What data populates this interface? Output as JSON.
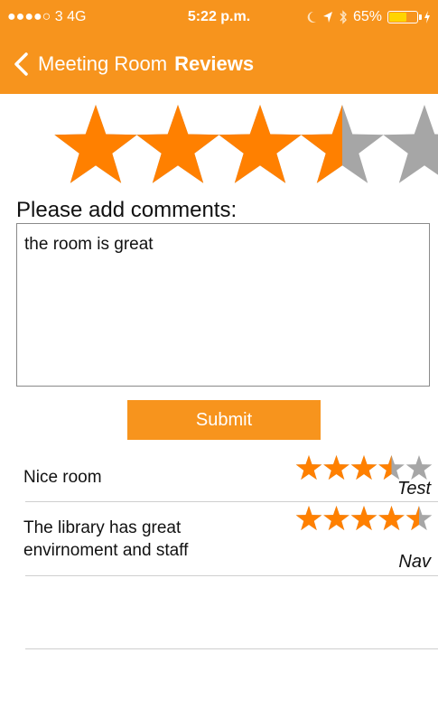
{
  "status_bar": {
    "carrier": "●●●●○ 3  4G",
    "time": "5:22 p.m.",
    "battery": "65%",
    "battery_level": 0.65,
    "icons": [
      "moon-icon",
      "location-arrow-icon",
      "bluetooth-icon",
      "battery-icon",
      "charging-icon"
    ]
  },
  "nav": {
    "back_label": "Meeting Room",
    "title": "Reviews"
  },
  "rating": {
    "value": 3.5,
    "max": 5
  },
  "comments": {
    "prompt": "Please add comments:",
    "value": "the room is great"
  },
  "submit_label": "Submit",
  "reviews": [
    {
      "text": "Nice room",
      "rating": 3.5,
      "max": 5,
      "user": "Test"
    },
    {
      "text": "The library has great envirnoment and staff",
      "rating": 4.5,
      "max": 5,
      "user": "Nav"
    }
  ],
  "colors": {
    "accent": "#f7941d",
    "star_filled": "#ff8000",
    "star_empty": "#a6a6a6"
  }
}
